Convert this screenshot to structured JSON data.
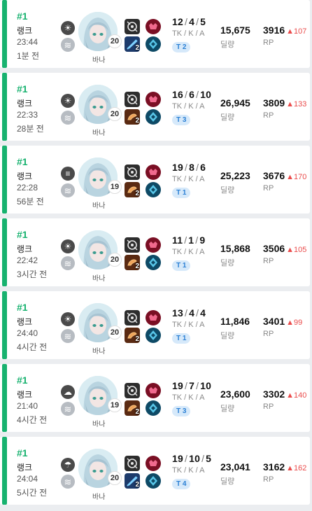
{
  "labels": {
    "kda": "TK / K / A",
    "damage": "딜량",
    "rp": "RP"
  },
  "colors": {
    "win": "#17b26f",
    "rp_up": "#ea4b4b",
    "tier_bg": "#d6e9fa",
    "tier_fg": "#2a7fd4"
  },
  "matches": [
    {
      "rank": "#1",
      "mode": "랭크",
      "duration": "23:44",
      "ago": "1분 전",
      "weather_icon": "sun-icon",
      "weather_glyph": "☀",
      "wind_icon": "fog-icon",
      "character": "바나",
      "level": "20",
      "weapon2_level": "2",
      "weapon_color": "blue",
      "kda": {
        "tk": "12",
        "k": "4",
        "a": "5"
      },
      "tier": "T 2",
      "damage": "15,675",
      "rp": "3916",
      "rp_delta": "▲107"
    },
    {
      "rank": "#1",
      "mode": "랭크",
      "duration": "22:33",
      "ago": "28분 전",
      "weather_icon": "sun-icon",
      "weather_glyph": "☀",
      "wind_icon": "fog-icon",
      "character": "바나",
      "level": "20",
      "weapon2_level": "2",
      "weapon_color": "orange",
      "kda": {
        "tk": "16",
        "k": "6",
        "a": "10"
      },
      "tier": "T 3",
      "damage": "26,945",
      "rp": "3809",
      "rp_delta": "▲133"
    },
    {
      "rank": "#1",
      "mode": "랭크",
      "duration": "22:28",
      "ago": "56분 전",
      "weather_icon": "filter-icon",
      "weather_glyph": "≡",
      "wind_icon": "fog-icon",
      "character": "바나",
      "level": "19",
      "weapon2_level": "2",
      "weapon_color": "orange",
      "kda": {
        "tk": "19",
        "k": "8",
        "a": "6"
      },
      "tier": "T 1",
      "damage": "25,223",
      "rp": "3676",
      "rp_delta": "▲170"
    },
    {
      "rank": "#1",
      "mode": "랭크",
      "duration": "22:42",
      "ago": "3시간 전",
      "weather_icon": "sun-icon",
      "weather_glyph": "☀",
      "wind_icon": "fog-icon",
      "character": "바나",
      "level": "20",
      "weapon2_level": "2",
      "weapon_color": "orange",
      "kda": {
        "tk": "11",
        "k": "1",
        "a": "9"
      },
      "tier": "T 1",
      "damage": "15,868",
      "rp": "3506",
      "rp_delta": "▲105"
    },
    {
      "rank": "#1",
      "mode": "랭크",
      "duration": "24:40",
      "ago": "4시간 전",
      "weather_icon": "sun-icon",
      "weather_glyph": "☀",
      "wind_icon": "fog-icon",
      "character": "바나",
      "level": "20",
      "weapon2_level": "2",
      "weapon_color": "orange",
      "kda": {
        "tk": "13",
        "k": "4",
        "a": "4"
      },
      "tier": "T 1",
      "damage": "11,846",
      "rp": "3401",
      "rp_delta": "▲99"
    },
    {
      "rank": "#1",
      "mode": "랭크",
      "duration": "21:40",
      "ago": "4시간 전",
      "weather_icon": "cloud-icon",
      "weather_glyph": "☁",
      "wind_icon": "fog-icon",
      "character": "바나",
      "level": "19",
      "weapon2_level": "2",
      "weapon_color": "orange",
      "kda": {
        "tk": "19",
        "k": "7",
        "a": "10"
      },
      "tier": "T 3",
      "damage": "23,600",
      "rp": "3302",
      "rp_delta": "▲140"
    },
    {
      "rank": "#1",
      "mode": "랭크",
      "duration": "24:04",
      "ago": "5시간 전",
      "weather_icon": "rain-icon",
      "weather_glyph": "☂",
      "wind_icon": "fog-icon",
      "character": "바나",
      "level": "20",
      "weapon2_level": "2",
      "weapon_color": "blue",
      "kda": {
        "tk": "19",
        "k": "10",
        "a": "5"
      },
      "tier": "T 4",
      "damage": "23,041",
      "rp": "3162",
      "rp_delta": "▲162"
    }
  ]
}
